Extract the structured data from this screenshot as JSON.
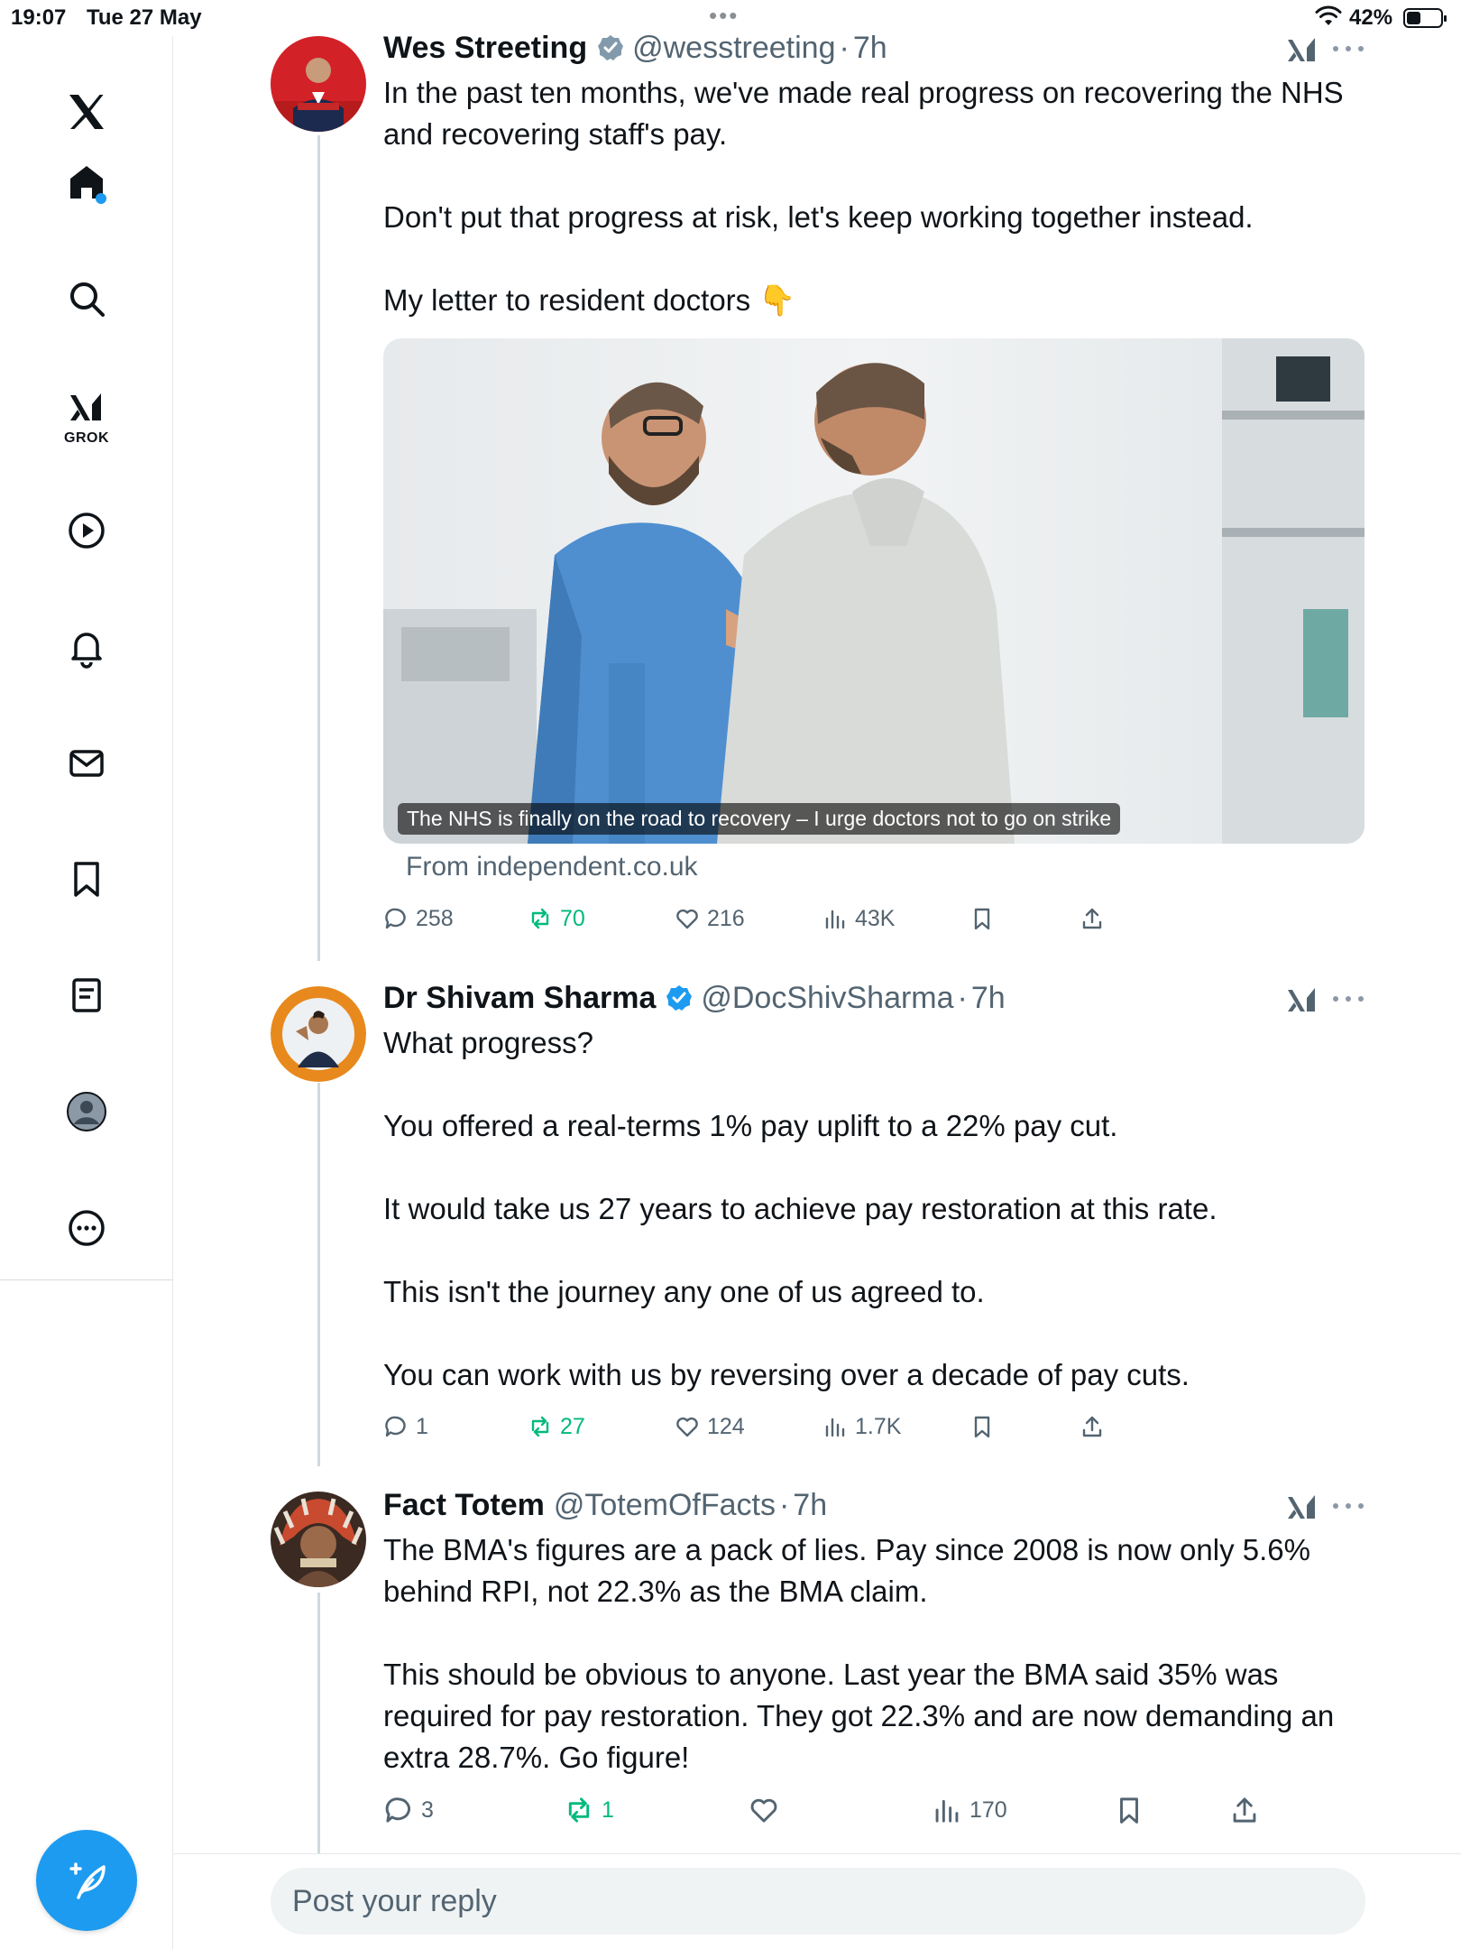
{
  "status_bar": {
    "time": "19:07",
    "date": "Tue 27 May",
    "battery": "42%",
    "battery_level": 0.42
  },
  "sidebar": {
    "items": [
      {
        "name": "x-logo",
        "icon": "x-logo-icon"
      },
      {
        "name": "home",
        "icon": "home-icon",
        "active": true,
        "has_notification_dot": true
      },
      {
        "name": "explore",
        "icon": "search-icon"
      },
      {
        "name": "grok",
        "icon": "grok-icon",
        "label": "GROK"
      },
      {
        "name": "video",
        "icon": "play-icon"
      },
      {
        "name": "notifications",
        "icon": "bell-icon"
      },
      {
        "name": "messages",
        "icon": "mail-icon"
      },
      {
        "name": "bookmarks",
        "icon": "bookmark-icon"
      },
      {
        "name": "lists",
        "icon": "list-icon"
      },
      {
        "name": "profile",
        "icon": "profile-icon"
      },
      {
        "name": "more",
        "icon": "more-circle-icon"
      }
    ],
    "compose_icon": "compose-feather-icon"
  },
  "tweets": [
    {
      "name": "Wes Streeting",
      "handle": "@wesstreeting",
      "sep": "·",
      "time": "7h",
      "verified": "grey",
      "text": "In the past ten months, we've made real progress on recovering the NHS and recovering staff's pay.\n\nDon't put that progress at risk, let's keep working together instead.\n\nMy letter to resident doctors 👇",
      "card": {
        "caption": "The NHS is finally on the road to recovery – I urge doctors not to go on strike",
        "source": "From independent.co.uk"
      },
      "stats": {
        "replies": "258",
        "reposts": "70",
        "likes": "216",
        "views": "43K"
      }
    },
    {
      "name": "Dr Shivam Sharma",
      "handle": "@DocShivSharma",
      "sep": "·",
      "time": "7h",
      "verified": "blue",
      "text": "What progress?\n\nYou offered a real-terms 1% pay uplift to a 22% pay cut.\n\nIt would take us 27 years to achieve pay restoration at this rate.\n\nThis isn't the journey any one of us agreed to.\n\nYou can work with us by reversing over a decade of pay cuts.",
      "stats": {
        "replies": "1",
        "reposts": "27",
        "likes": "124",
        "views": "1.7K"
      }
    },
    {
      "name": "Fact Totem",
      "handle": "@TotemOfFacts",
      "sep": "·",
      "time": "7h",
      "verified": "none",
      "text": "The BMA's figures are a pack of lies. Pay since 2008 is now only 5.6% behind RPI, not 22.3% as the BMA claim.\n\nThis should be obvious to anyone. Last year the BMA said 35% was required for pay restoration. They got 22.3% and are now demanding an extra 28.7%. Go figure!",
      "stats": {
        "replies": "3",
        "reposts": "1",
        "likes": "",
        "views": "170"
      }
    }
  ],
  "reply": {
    "placeholder": "Post your reply"
  },
  "colors": {
    "accent": "#1d9bf0",
    "repost_green": "#00ba7c",
    "muted_text": "#536471",
    "thread_line": "#cfd9de"
  }
}
